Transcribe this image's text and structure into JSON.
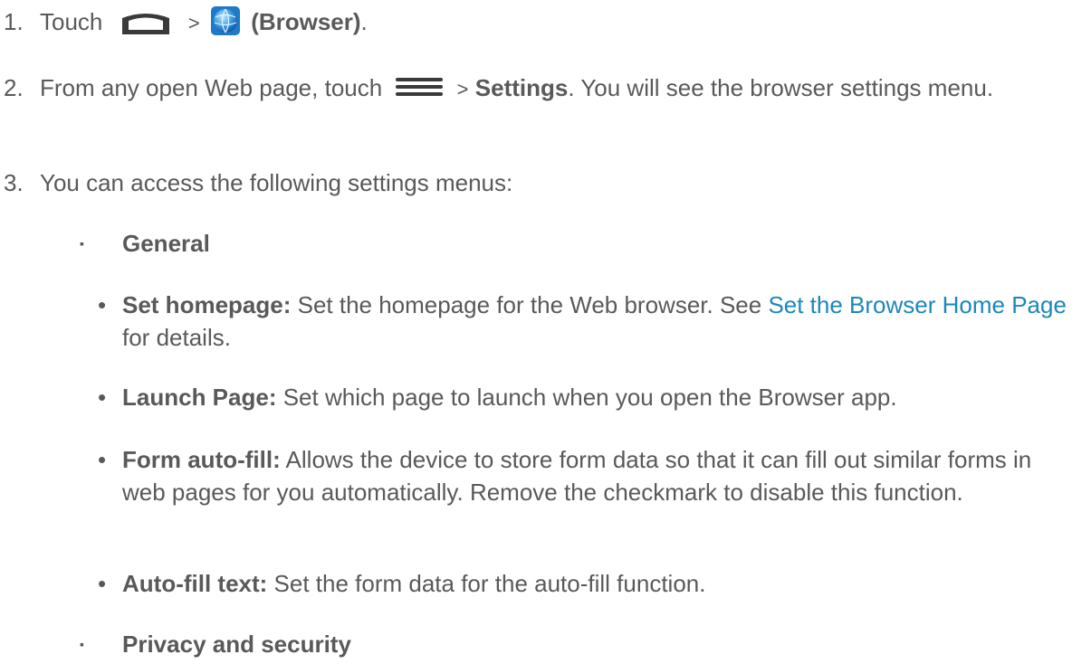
{
  "step1": {
    "num": "1.",
    "pre": "Touch",
    "sep": ">",
    "bold": "(Browser)",
    "post": ".",
    "home_icon": "home-icon",
    "browser_icon": "globe-browser-icon"
  },
  "step2": {
    "num": "2.",
    "pre": "From any open Web page, touch",
    "sep": ">",
    "bold": "Settings",
    "post": ". You will see the browser settings menu.",
    "menu_icon": "menu-icon"
  },
  "step3": {
    "num": "3.",
    "text": "You can access the following settings menus:"
  },
  "bullets": [
    {
      "mark": "▪",
      "label": "General"
    },
    {
      "mark": "▪",
      "label": "Privacy and security"
    }
  ],
  "general_items": [
    {
      "mark": "•",
      "term": "Set homepage:",
      "text_pre": " Set the homepage for the Web browser. See ",
      "link": "Set the Browser Home Page",
      "text_post": " for details."
    },
    {
      "mark": "•",
      "term": "Launch Page:",
      "text": " Set which page to launch when you open the Browser app."
    },
    {
      "mark": "•",
      "term": "Form auto-fill:",
      "text": " Allows the device to store form data so that it can fill out similar forms in web pages for you automatically. Remove the checkmark to disable this function."
    },
    {
      "mark": "•",
      "term": "Auto-fill text:",
      "text": " Set the form data for the auto-fill function."
    }
  ],
  "colors": {
    "body_text": "#595959",
    "link": "#1b88b9"
  }
}
